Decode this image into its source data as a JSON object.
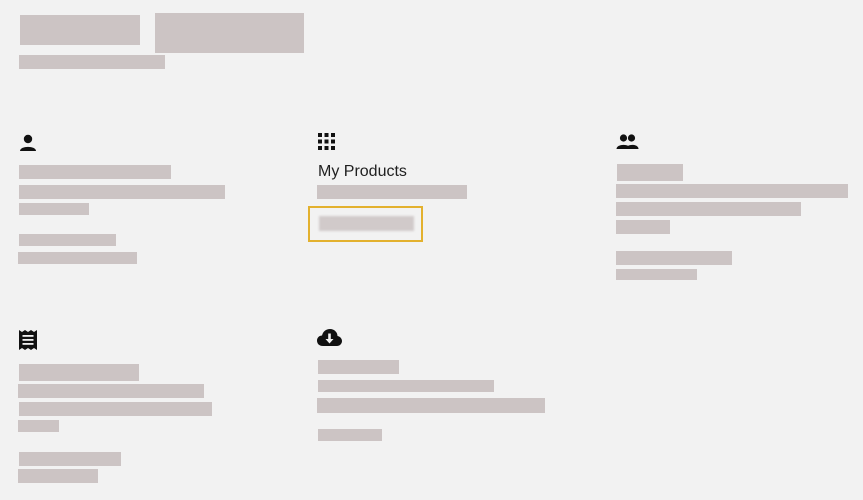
{
  "window": {
    "background": "#f2f2f2",
    "placeholder_color": "#ccc4c4",
    "focus_color": "#e3b12e"
  },
  "header": {
    "title_redacted": true,
    "subtitle_redacted": true
  },
  "cards": [
    {
      "id": "account",
      "icon": "person-icon"
    },
    {
      "id": "products",
      "icon": "apps-grid-icon",
      "title": "My Products"
    },
    {
      "id": "family",
      "icon": "people-icon"
    },
    {
      "id": "orders",
      "icon": "receipt-icon"
    },
    {
      "id": "downloads",
      "icon": "cloud-download-icon"
    }
  ]
}
